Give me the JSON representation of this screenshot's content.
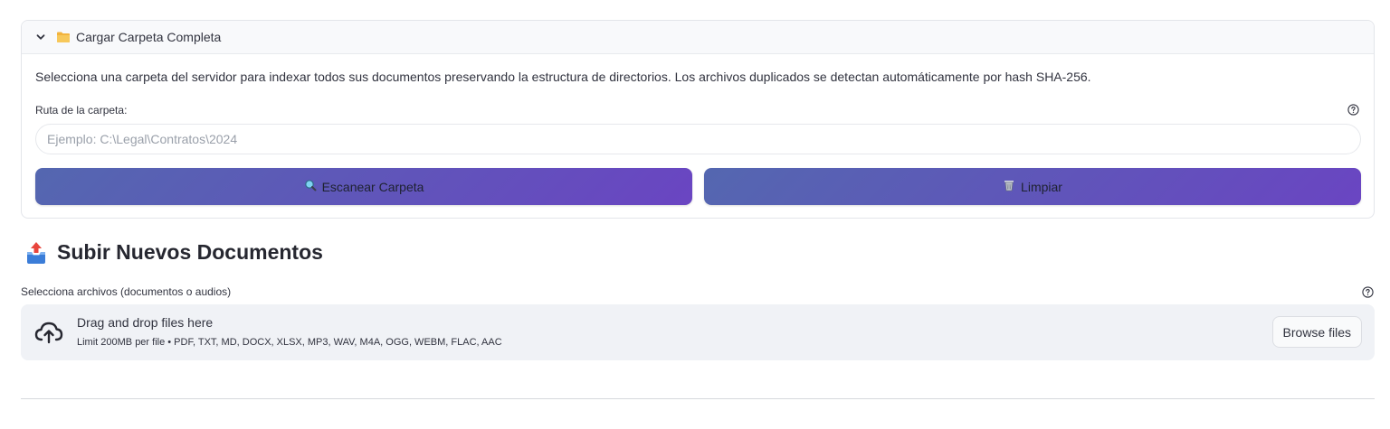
{
  "expander": {
    "title": "Cargar Carpeta Completa",
    "description": "Selecciona una carpeta del servidor para indexar todos sus documentos preservando la estructura de directorios. Los archivos duplicados se detectan automáticamente por hash SHA-256.",
    "folder_field": {
      "label": "Ruta de la carpeta:",
      "placeholder": "Ejemplo: C:\\Legal\\Contratos\\2024",
      "value": ""
    },
    "scan_button": {
      "icon": "magnifier-icon",
      "label": "Escanear Carpeta"
    },
    "clear_button": {
      "icon": "wastebasket-icon",
      "label": "Limpiar"
    }
  },
  "upload_section": {
    "title": "Subir Nuevos Documentos",
    "uploader_label": "Selecciona archivos (documentos o audios)",
    "dropzone": {
      "title": "Drag and drop files here",
      "limits": "Limit 200MB per file • PDF, TXT, MD, DOCX, XLSX, MP3, WAV, M4A, OGG, WEBM, FLAC, AAC",
      "browse_label": "Browse files"
    }
  },
  "colors": {
    "button_gradient_start": "#5467b0",
    "button_gradient_end": "#6a45c2",
    "dropzone_bg": "#f0f2f6"
  }
}
